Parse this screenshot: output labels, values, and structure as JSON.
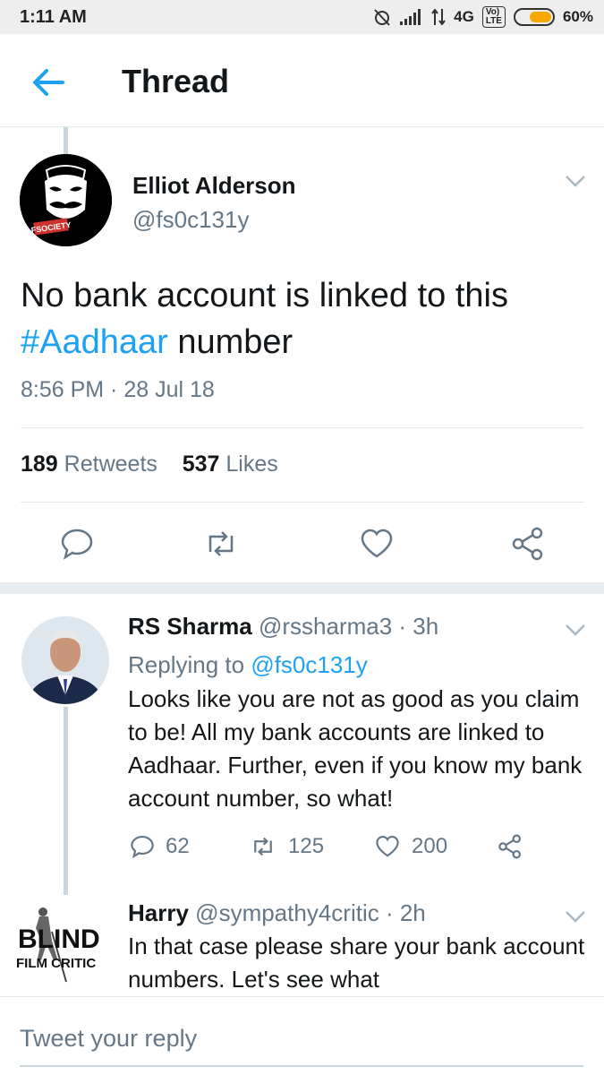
{
  "status_bar": {
    "time": "1:11 AM",
    "network": "4G",
    "volte": "Vo) LTE",
    "battery": "60%",
    "battery_level": 0.6
  },
  "header": {
    "title": "Thread",
    "back_icon": "arrow-left-icon"
  },
  "main_tweet": {
    "name": "Elliot Alderson",
    "handle": "@fs0c131y",
    "avatar_label": "FSOCIETY",
    "text_before": "No bank account is linked to this ",
    "hashtag": "#Aadhaar",
    "text_after": " number",
    "timestamp": "8:56 PM · 28 Jul 18",
    "retweets_count": "189",
    "retweets_label": "Retweets",
    "likes_count": "537",
    "likes_label": "Likes",
    "actions": [
      "reply-icon",
      "retweet-icon",
      "like-icon",
      "share-icon"
    ]
  },
  "replies": [
    {
      "name": "RS Sharma",
      "handle": "@rssharma3",
      "time": "· 3h",
      "replying_label": "Replying to",
      "replying_to": "@fs0c131y",
      "text": "Looks like you are not as good as you claim to be! All my bank accounts are linked to Aadhaar. Further, even if you know my bank account number, so what!",
      "reply_count": "62",
      "retweet_count": "125",
      "like_count": "200"
    },
    {
      "name": "Harry",
      "handle": "@sympathy4critic",
      "time": "· 2h",
      "avatar_label_1": "BLIND",
      "avatar_label_2": "FILM CRITIC",
      "text": "In that case please share your bank account numbers. Let's see what"
    }
  ],
  "composer": {
    "placeholder": "Tweet your reply"
  },
  "colors": {
    "accent": "#1da1f2",
    "secondary_text": "#657786",
    "divider": "#e1e8ed"
  }
}
